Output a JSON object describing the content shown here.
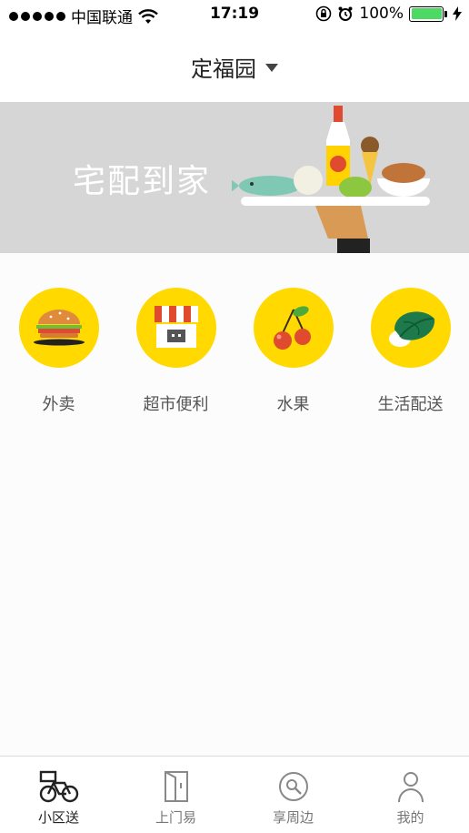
{
  "status_bar": {
    "carrier": "中国联通",
    "time": "17:19",
    "battery_percent": "100%",
    "battery_level": 1.0
  },
  "header": {
    "location": "定福园"
  },
  "banner": {
    "title": "宅配到家"
  },
  "categories": [
    {
      "label": "外卖",
      "icon": "burger-icon"
    },
    {
      "label": "超市便利",
      "icon": "store-icon"
    },
    {
      "label": "水果",
      "icon": "cherry-icon"
    },
    {
      "label": "生活配送",
      "icon": "vegetable-icon"
    }
  ],
  "tabbar": {
    "active": "小区送",
    "tabs": [
      {
        "label": "小区送",
        "icon": "bicycle-icon"
      },
      {
        "label": "上门易",
        "icon": "door-icon"
      },
      {
        "label": "享周边",
        "icon": "search-around-icon"
      },
      {
        "label": "我的",
        "icon": "person-icon"
      }
    ]
  },
  "colors": {
    "accent_yellow": "#ffd900",
    "banner_gray": "#d6d6d6",
    "battery_green": "#4cd964"
  }
}
